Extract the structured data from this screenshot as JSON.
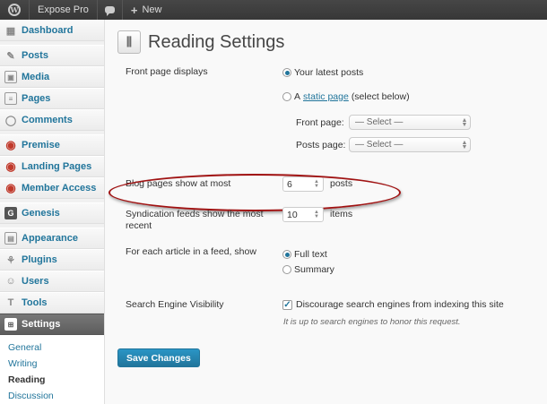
{
  "adminbar": {
    "site_name": "Expose Pro",
    "new_label": "New"
  },
  "sidebar": {
    "items": [
      {
        "label": "Dashboard",
        "icon": "dashboard-icon"
      },
      {
        "label": "Posts",
        "icon": "pin-icon"
      },
      {
        "label": "Media",
        "icon": "media-icon"
      },
      {
        "label": "Pages",
        "icon": "page-icon"
      },
      {
        "label": "Comments",
        "icon": "comment-icon"
      },
      {
        "label": "Premise",
        "icon": "target-icon"
      },
      {
        "label": "Landing Pages",
        "icon": "target-icon"
      },
      {
        "label": "Member Access",
        "icon": "target-icon"
      },
      {
        "label": "Genesis",
        "icon": "genesis-icon"
      },
      {
        "label": "Appearance",
        "icon": "appearance-icon"
      },
      {
        "label": "Plugins",
        "icon": "plugin-icon"
      },
      {
        "label": "Users",
        "icon": "users-icon"
      },
      {
        "label": "Tools",
        "icon": "tools-icon"
      },
      {
        "label": "Settings",
        "icon": "settings-icon"
      }
    ],
    "submenu": [
      "General",
      "Writing",
      "Reading",
      "Discussion"
    ]
  },
  "main": {
    "title": "Reading Settings",
    "front_page_label": "Front page displays",
    "option_latest": "Your latest posts",
    "option_static_prefix": "A",
    "option_static_link": "static page",
    "option_static_suffix": "(select below)",
    "front_page_select_label": "Front page:",
    "posts_page_select_label": "Posts page:",
    "select_placeholder": "— Select —",
    "blog_pages_label": "Blog pages show at most",
    "blog_pages_value": "6",
    "blog_pages_unit": "posts",
    "syndication_label_line1": "Syndication feeds show the most",
    "syndication_label_line2": "recent",
    "syndication_value": "10",
    "syndication_unit": "items",
    "feed_article_label": "For each article in a feed, show",
    "option_full_text": "Full text",
    "option_summary": "Summary",
    "search_visibility_label": "Search Engine Visibility",
    "discourage_label": "Discourage search engines from indexing this site",
    "discourage_hint": "It is up to search engines to honor this request.",
    "save_button": "Save Changes"
  },
  "colors": {
    "accent": "#21759b",
    "highlight_ring": "#a01212"
  }
}
